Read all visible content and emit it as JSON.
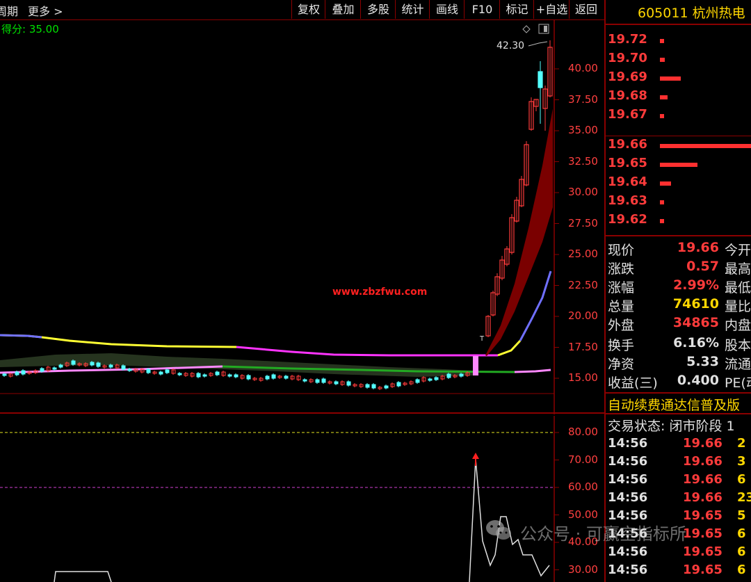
{
  "toolbar": {
    "period": "周期",
    "more": "更多",
    "buttons": [
      "复权",
      "叠加",
      "多股",
      "统计",
      "画线",
      "F10",
      "标记",
      "+自选",
      "返回"
    ]
  },
  "score": "得分: 35.00",
  "price_axis": [
    "40.00",
    "37.50",
    "35.00",
    "32.50",
    "30.00",
    "27.50",
    "25.00",
    "22.50",
    "20.00",
    "17.50",
    "15.00"
  ],
  "high_marker": "42.30",
  "sub_axis": [
    "80.00",
    "70.00",
    "60.00",
    "50.00",
    "40.00",
    "30.00"
  ],
  "center_watermark": "www.zbzfwu.com",
  "stock": {
    "code": "605011",
    "name": "杭州热电"
  },
  "orderbook": [
    {
      "price": "19.72",
      "bar": 0.02
    },
    {
      "price": "19.70",
      "bar": 0.05
    },
    {
      "price": "19.69",
      "bar": 0.22
    },
    {
      "price": "19.68",
      "bar": 0.08
    },
    {
      "price": "19.67",
      "bar": 0.04
    },
    {
      "price": "19.66",
      "bar": 1.0
    },
    {
      "price": "19.65",
      "bar": 0.4
    },
    {
      "price": "19.64",
      "bar": 0.12
    },
    {
      "price": "19.63",
      "bar": 0.02
    },
    {
      "price": "19.62",
      "bar": 0.02
    }
  ],
  "quotes": [
    {
      "name": "现价",
      "value": "19.66",
      "color": "#ff3b3b",
      "tail": "今开"
    },
    {
      "name": "涨跌",
      "value": "0.57",
      "color": "#ff3b3b",
      "tail": "最高"
    },
    {
      "name": "涨幅",
      "value": "2.99%",
      "color": "#ff3b3b",
      "tail": "最低"
    },
    {
      "name": "总量",
      "value": "74610",
      "color": "#ffd700",
      "tail": "量比"
    },
    {
      "name": "外盘",
      "value": "34865",
      "color": "#ff3b3b",
      "tail": "内盘"
    },
    {
      "name": "换手",
      "value": "6.16%",
      "color": "#e0e0e0",
      "tail": "股本"
    },
    {
      "name": "净资",
      "value": "5.33",
      "color": "#e0e0e0",
      "tail": "流通"
    },
    {
      "name": "收益(三)",
      "value": "0.400",
      "color": "#e0e0e0",
      "tail": "PE(动"
    }
  ],
  "ad_text": "自动续费通达信普及版",
  "trade_state": "交易状态: 闭市阶段 1",
  "ticks": [
    {
      "time": "14:56",
      "price": "19.66",
      "vol": "2"
    },
    {
      "time": "14:56",
      "price": "19.66",
      "vol": "3"
    },
    {
      "time": "14:56",
      "price": "19.66",
      "vol": "6"
    },
    {
      "time": "14:56",
      "price": "19.66",
      "vol": "23"
    },
    {
      "time": "14:56",
      "price": "19.65",
      "vol": "5"
    },
    {
      "time": "14:56",
      "price": "19.65",
      "vol": "6"
    },
    {
      "time": "14:56",
      "price": "19.65",
      "vol": "6"
    },
    {
      "time": "14:56",
      "price": "19.65",
      "vol": "6"
    }
  ],
  "watermark": "公众号 · 可赢空指标所",
  "colors": {
    "up": "#ff3b3b",
    "down": "#54ffff",
    "frame": "#8b0000",
    "gold": "#ffd700"
  }
}
